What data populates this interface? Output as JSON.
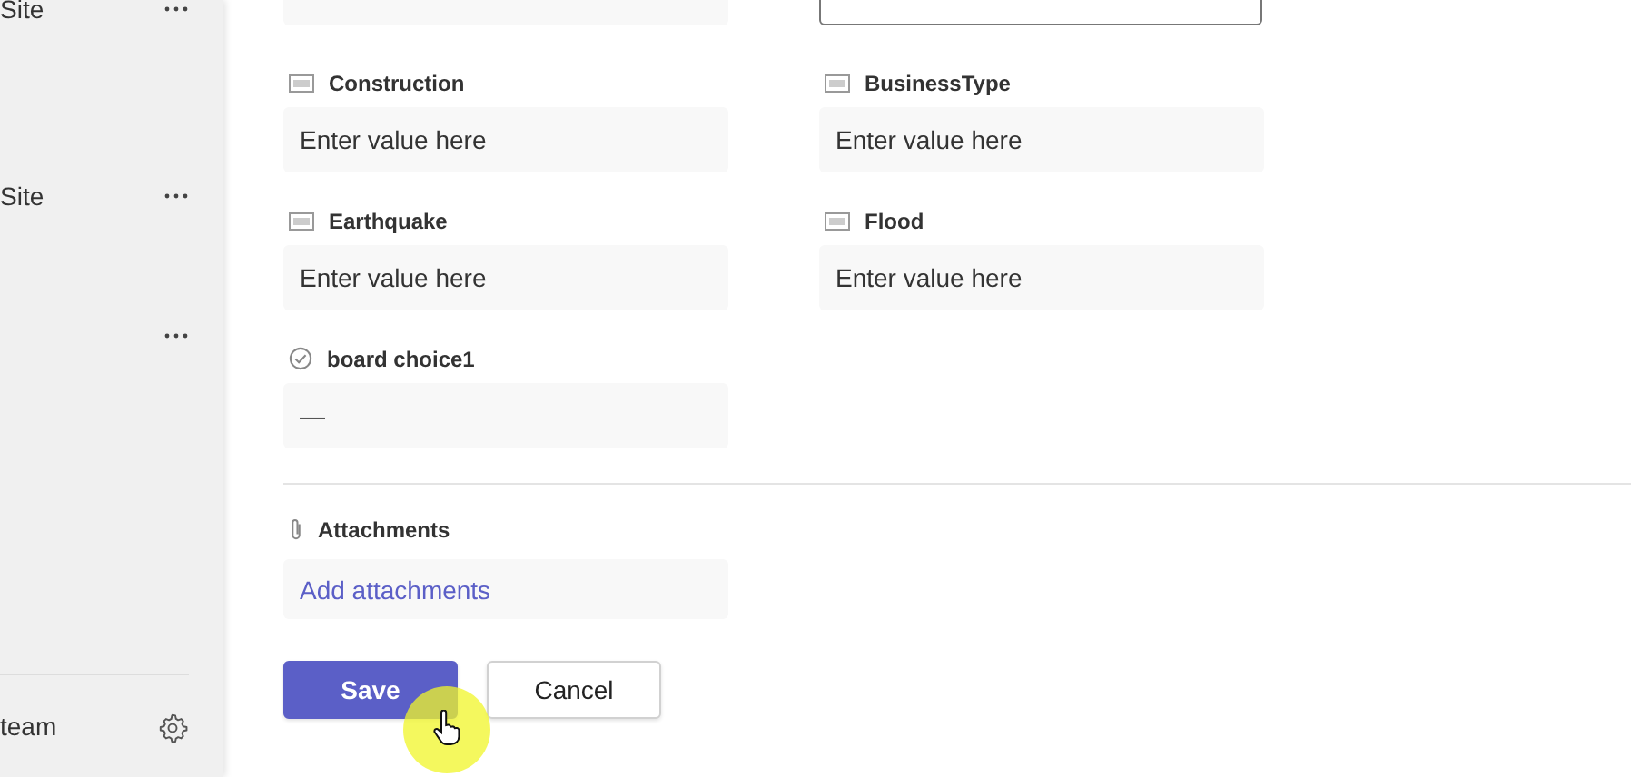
{
  "sidebar": {
    "items": [
      {
        "label": "Site",
        "has_menu": true
      },
      {
        "label": "Site",
        "has_menu": true
      },
      {
        "has_menu": true
      }
    ],
    "footer": {
      "label": "team"
    }
  },
  "form": {
    "top_row": [
      {
        "kind": "text"
      },
      {
        "kind": "number"
      }
    ],
    "fields": [
      {
        "kind": "text",
        "label": "Construction",
        "placeholder": "Enter value here"
      },
      {
        "kind": "text",
        "label": "BusinessType",
        "placeholder": "Enter value here"
      },
      {
        "kind": "text",
        "label": "Earthquake",
        "placeholder": "Enter value here"
      },
      {
        "kind": "text",
        "label": "Flood",
        "placeholder": "Enter value here"
      },
      {
        "kind": "choice",
        "label": "board choice1",
        "value": "—"
      }
    ],
    "attachments": {
      "label": "Attachments",
      "link": "Add attachments"
    },
    "buttons": [
      {
        "kind": "primary",
        "label": "Save"
      },
      {
        "kind": "secondary",
        "label": "Cancel"
      }
    ]
  }
}
